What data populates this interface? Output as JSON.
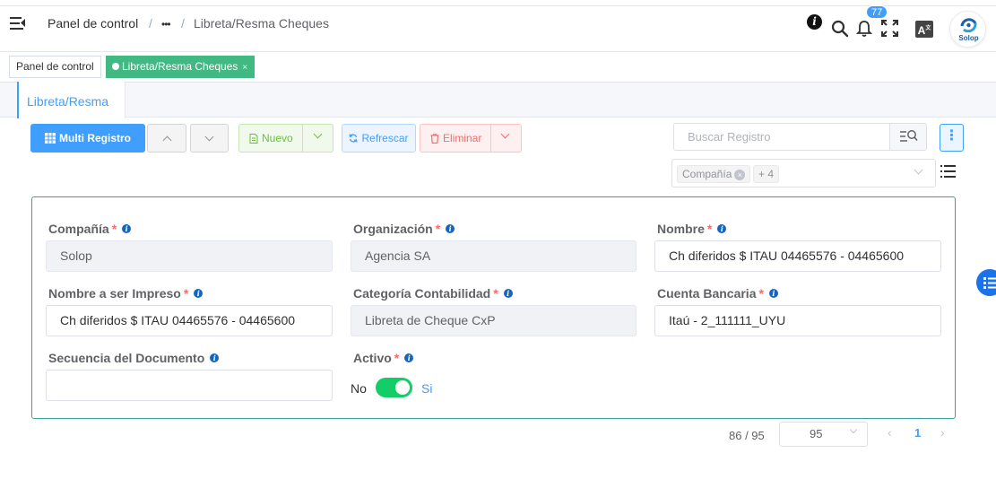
{
  "header": {
    "breadcrumb": [
      "Panel de control",
      "•••",
      "Libreta/Resma Cheques"
    ],
    "separator": "/",
    "notifications_count": "77",
    "lang_label": "A",
    "avatar_label": "Solop"
  },
  "tags": [
    {
      "label": "Panel de control",
      "active": false
    },
    {
      "label": "Libreta/Resma Cheques",
      "active": true,
      "close": "×"
    }
  ],
  "tab": {
    "label": "Libreta/Resma"
  },
  "toolbar": {
    "multi_registro": "Multi Registro",
    "nuevo": "Nuevo",
    "refrescar": "Refrescar",
    "eliminar": "Eliminar"
  },
  "search": {
    "placeholder": "Buscar Registro"
  },
  "filter": {
    "chip": "Compañía",
    "more": "+ 4"
  },
  "form": {
    "compania": {
      "label": "Compañía",
      "value": "Solop",
      "required": true
    },
    "organizacion": {
      "label": "Organización",
      "value": "Agencia SA",
      "required": true
    },
    "nombre": {
      "label": "Nombre",
      "value": "Ch diferidos $ ITAU 04465576 - 04465600",
      "required": true
    },
    "nombre_impreso": {
      "label": "Nombre a ser Impreso",
      "value": "Ch diferidos $ ITAU 04465576 - 04465600",
      "required": true
    },
    "categoria": {
      "label": "Categoría Contabilidad",
      "value": "Libreta de Cheque CxP",
      "required": true
    },
    "cuenta": {
      "label": "Cuenta Bancaria",
      "value": "Itaú - 2_111111_UYU",
      "required": true
    },
    "secuencia": {
      "label": "Secuencia del Documento",
      "value": ""
    },
    "activo": {
      "label": "Activo",
      "off_label": "No",
      "on_label": "Si",
      "checked": true
    }
  },
  "pagination": {
    "record": "86 / 95",
    "page_size": "95",
    "current_page": "1"
  },
  "colors": {
    "primary": "#409eff",
    "success": "#67c23a",
    "danger": "#f56c6c",
    "card_border": "#36a3a0",
    "switch_on": "#13ce66"
  }
}
